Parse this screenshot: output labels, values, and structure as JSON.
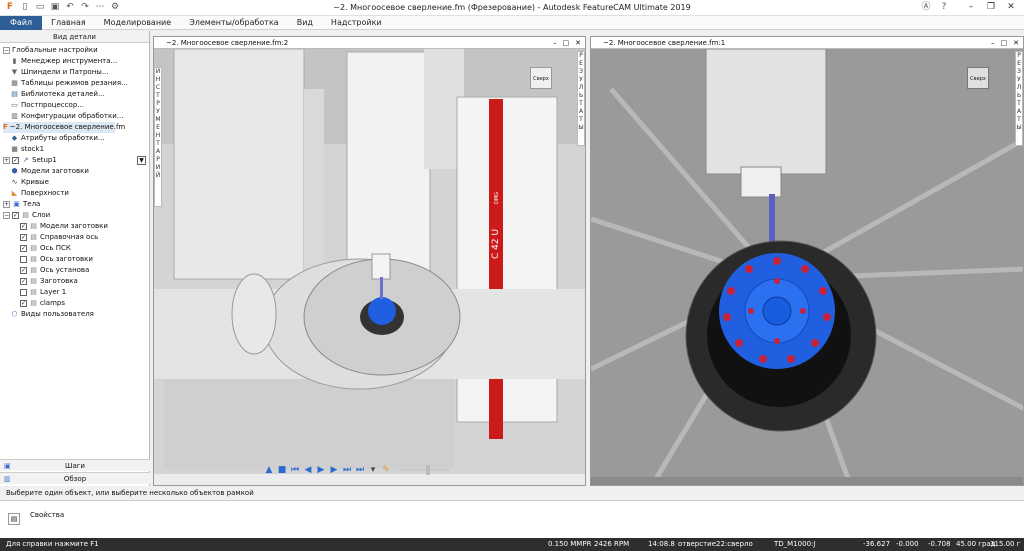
{
  "window": {
    "title": "~2. Многоосевое сверление.fm (Фрезерование) - Autodesk FeatureCAM Ultimate 2019"
  },
  "menu": {
    "file": "Файл",
    "items": [
      "Главная",
      "Моделирование",
      "Элементы/обработка",
      "Вид",
      "Надстройки"
    ]
  },
  "left_panel": {
    "header": "Вид детали",
    "tree": [
      {
        "label": "Глобальные настройки"
      },
      {
        "label": "Менеджер инструмента..."
      },
      {
        "label": "Шпиндели и Патроны..."
      },
      {
        "label": "Таблицы режимов резания..."
      },
      {
        "label": "Библиотека деталей..."
      },
      {
        "label": "Постпроцессор..."
      },
      {
        "label": "Конфигурации обработки..."
      },
      {
        "label": "~2. Многоосевое сверление.fm"
      },
      {
        "label": "Атрибуты обработки..."
      },
      {
        "label": "stock1"
      },
      {
        "label": "Setup1"
      },
      {
        "label": "Модели заготовки"
      },
      {
        "label": "Кривые"
      },
      {
        "label": "Поверхности"
      },
      {
        "label": "Тела"
      },
      {
        "label": "Слои"
      },
      {
        "label": "Модели заготовки"
      },
      {
        "label": "Справочная ось"
      },
      {
        "label": "Ось ПСК"
      },
      {
        "label": "Ось заготовки"
      },
      {
        "label": "Ось установа"
      },
      {
        "label": "Заготовка"
      },
      {
        "label": "Layer 1"
      },
      {
        "label": "clamps"
      },
      {
        "label": "Виды пользователя"
      }
    ],
    "steps": "Шаги",
    "overview": "Обзор"
  },
  "viewport_left": {
    "title": "~2. Многоосевое сверление.fm:2",
    "side_tab": [
      "И",
      "Н",
      "С",
      "Т",
      "Р",
      "У",
      "М",
      "Е",
      "Н",
      "Т",
      "А",
      "Р",
      "И",
      "Й"
    ],
    "right_tab": [
      "Р",
      "Е",
      "З",
      "У",
      "Л",
      "Ь",
      "Т",
      "А",
      "Т",
      "Ы"
    ],
    "cube_label": "Сверх",
    "machine_label": "C 42 U",
    "machine_small": "DMG"
  },
  "viewport_right": {
    "title": "~2. Многоосевое сверление.fm:1",
    "right_tab": [
      "Р",
      "Е",
      "З",
      "У",
      "Л",
      "Ь",
      "Т",
      "А",
      "Т",
      "Ы"
    ],
    "cube_label": "Сверх"
  },
  "status": {
    "prompt": "Выберите один объект, или выберите несколько объектов рамкой",
    "properties": "Свойства",
    "help": "Для справки нажмите F1",
    "feed": "0.150 MMPR",
    "rpm": "2426 RPM",
    "time": "14:08.8",
    "op": "отверстие22:сверло",
    "tool": "TD_M1000:J",
    "x": "-36.627",
    "y": "-0.000",
    "z": "-0.708",
    "a": "45.00 град",
    "c": "315.00 г"
  },
  "colors": {
    "accent": "#2d5f96",
    "part": "#1f5fe0",
    "red_stripe": "#cc1a1a"
  }
}
